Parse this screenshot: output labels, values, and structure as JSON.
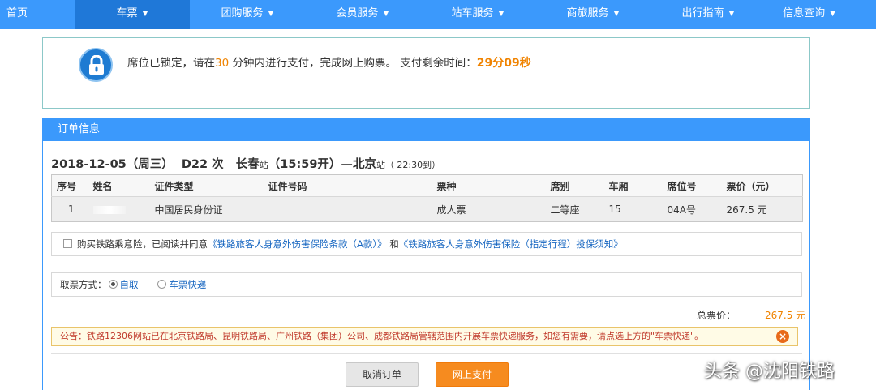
{
  "nav": {
    "items": [
      {
        "label": "首页",
        "chevron": false
      },
      {
        "label": "车票",
        "chevron": true,
        "active": true
      },
      {
        "label": "团购服务",
        "chevron": true
      },
      {
        "label": "会员服务",
        "chevron": true
      },
      {
        "label": "站车服务",
        "chevron": true
      },
      {
        "label": "商旅服务",
        "chevron": true
      },
      {
        "label": "出行指南",
        "chevron": true
      },
      {
        "label": "信息查询",
        "chevron": true
      }
    ]
  },
  "notice": {
    "icon": "lock-icon",
    "text_before": "席位已锁定，请在",
    "minutes": "30",
    "text_after": " 分钟内进行支付，完成网上购票。 支付剩余时间：",
    "countdown": "29分09秒"
  },
  "order": {
    "panel_title": "订单信息",
    "date": "2018-12-05（周三）",
    "train": "D22 次",
    "from_station": "长春",
    "station_suffix": "站",
    "depart_time": "（15:59开）—",
    "to_station": "北京",
    "arrive": "（ 22:30到）",
    "columns": [
      "序号",
      "姓名",
      "证件类型",
      "证件号码",
      "票种",
      "席别",
      "车厢",
      "席位号",
      "票价（元）"
    ],
    "row": {
      "no": "1",
      "id_type": "中国居民身份证",
      "ticket_type": "成人票",
      "seat_class": "二等座",
      "car": "15",
      "seat_no": "04A号",
      "price": "267.5 元"
    }
  },
  "insurance": {
    "text": "购买铁路乘意险，已阅读并同意",
    "link1": "《铁路旅客人身意外伤害保险条款（A款）》",
    "and": " 和",
    "link2": "《铁路旅客人身意外伤害保险（指定行程）投保须知》"
  },
  "pickup": {
    "label": "取票方式：",
    "option1": "自取",
    "option2": "车票快递"
  },
  "total": {
    "label": "总票价：",
    "amount": "267.5 元"
  },
  "announcement": "公告：铁路12306网站已在北京铁路局、昆明铁路局、广州铁路（集团）公司、成都铁路局管辖范围内开展车票快递服务，如您有需要，请点选上方的\"车票快递\"。",
  "buttons": {
    "cancel": "取消订单",
    "pay": "网上支付"
  },
  "watermark": "头条 @沈阳铁路",
  "colors": {
    "nav_blue": "#3b99fc",
    "nav_active": "#1f78d8",
    "accent_orange": "#f08300",
    "link_blue": "#1565c0"
  }
}
